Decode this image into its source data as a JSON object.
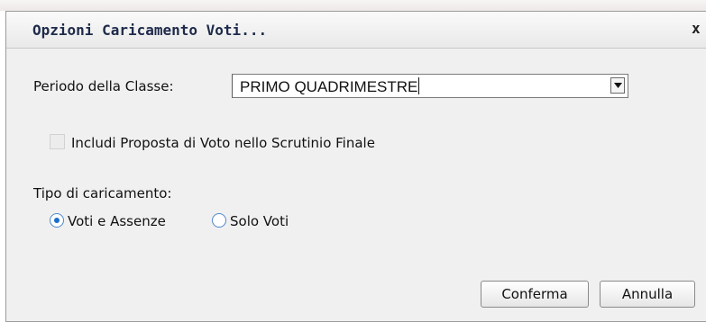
{
  "dialog": {
    "title": "Opzioni Caricamento Voti...",
    "close_label": "x"
  },
  "periodo": {
    "label": "Periodo della Classe:",
    "selected": "PRIMO QUADRIMESTRE"
  },
  "includi": {
    "label": "Includi Proposta di Voto nello Scrutinio Finale",
    "checked": false
  },
  "tipo": {
    "label": "Tipo di caricamento:",
    "options": [
      {
        "label": "Voti e Assenze",
        "selected": true
      },
      {
        "label": "Solo Voti",
        "selected": false
      }
    ]
  },
  "buttons": {
    "confirm": "Conferma",
    "cancel": "Annulla"
  }
}
